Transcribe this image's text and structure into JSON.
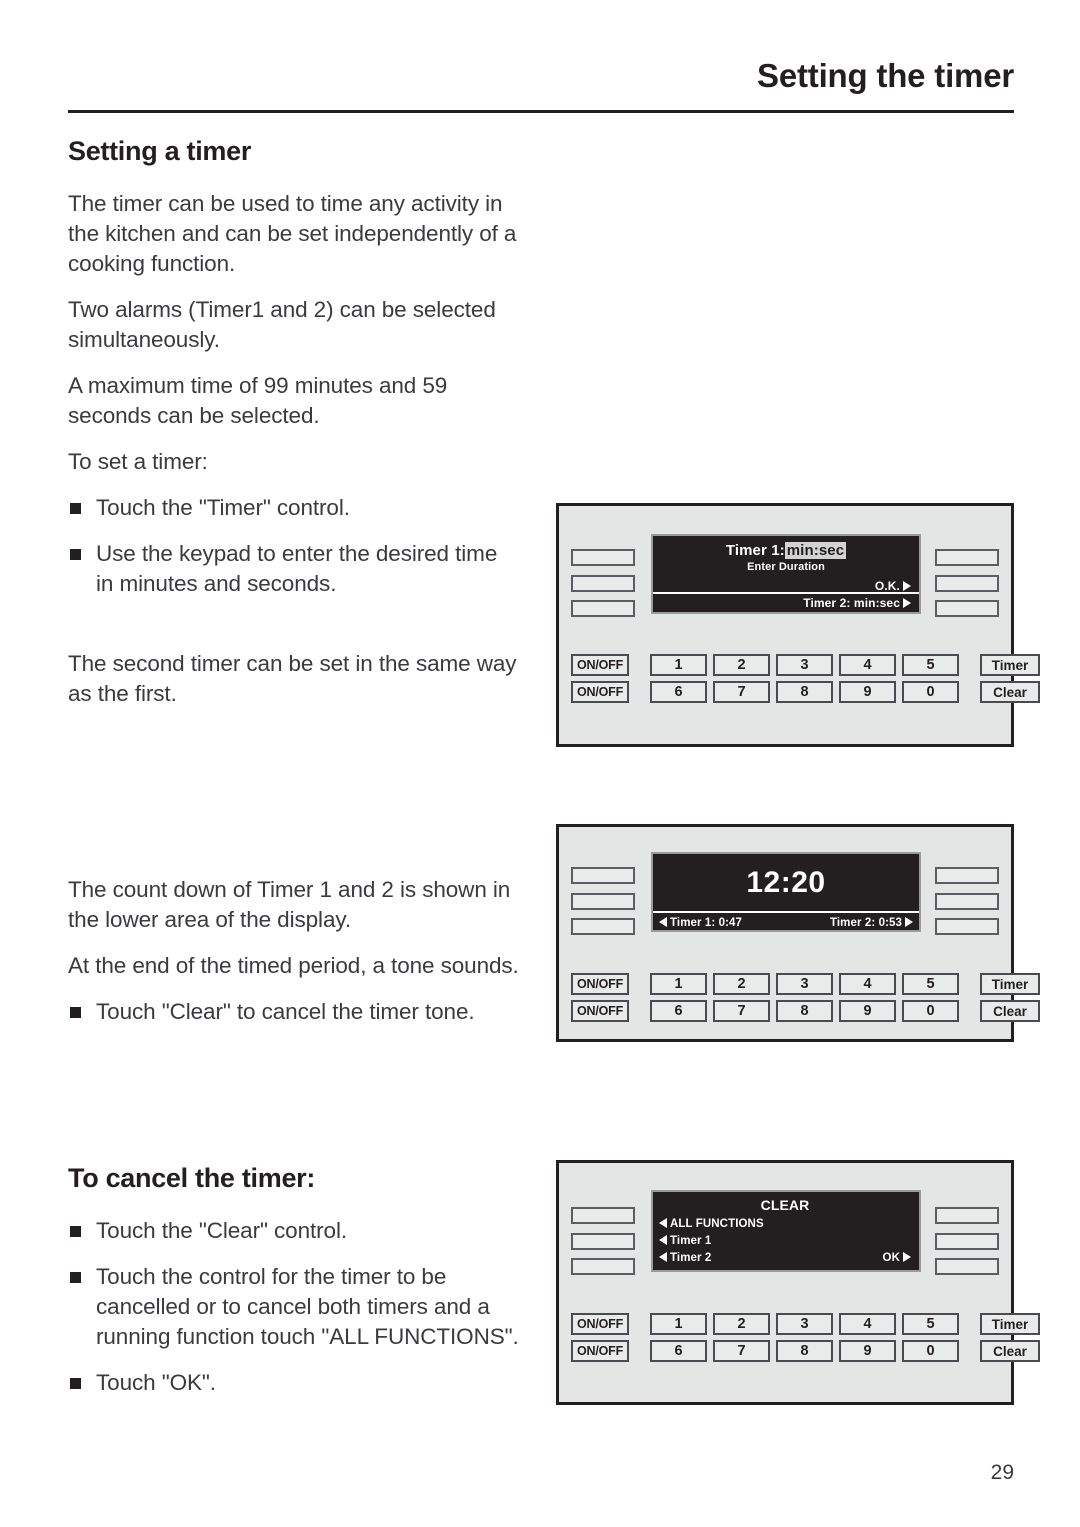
{
  "header": {
    "title": "Setting the timer"
  },
  "page_number": "29",
  "sections": {
    "setting_a_timer": {
      "heading": "Setting a timer",
      "paragraphs": [
        "The timer can be used to time any activity in the kitchen and can be set independently of a cooking function.",
        "Two alarms (Timer1 and 2) can be selected simultaneously.",
        "A maximum time of 99 minutes and 59 seconds can be selected.",
        "To set a timer:"
      ],
      "bullets": [
        "Touch the \"Timer\" control.",
        "Use the keypad to enter the desired time in minutes and seconds."
      ],
      "after_bullets": "The second timer can be set in the same way as the first."
    },
    "countdown": {
      "paragraphs": [
        "The count down of Timer 1 and 2 is shown in the lower area of the display.",
        "At the end of the timed period, a tone sounds."
      ],
      "bullets": [
        "Touch \"Clear\" to cancel the timer tone."
      ]
    },
    "cancel_the_timer": {
      "heading": "To cancel the timer:",
      "bullets": [
        "Touch the \"Clear\" control.",
        "Touch the control for the timer to be cancelled or to cancel both timers and a running function touch \"ALL FUNCTIONS\".",
        "Touch \"OK\"."
      ]
    }
  },
  "keypad": {
    "onoff_label": "ON/OFF",
    "row1": [
      "1",
      "2",
      "3",
      "4",
      "5"
    ],
    "row2": [
      "6",
      "7",
      "8",
      "9",
      "0"
    ],
    "timer_label": "Timer",
    "clear_label": "Clear"
  },
  "panels": {
    "panel1": {
      "display": {
        "title_prefix": "Timer 1:",
        "title_value": "min:sec",
        "subtitle": "Enter Duration",
        "ok_label": "O.K.",
        "bottom_bar": "Timer 2: min:sec"
      }
    },
    "panel2": {
      "display": {
        "clock": "12:20",
        "timer1": "Timer 1: 0:47",
        "timer2": "Timer 2: 0:53"
      }
    },
    "panel3": {
      "display": {
        "title": "CLEAR",
        "items": [
          "ALL FUNCTIONS",
          "Timer 1",
          "Timer 2"
        ],
        "ok_label": "OK"
      }
    }
  },
  "colors": {
    "ink": "#231f20",
    "body_text": "#3b3b3f",
    "panel_bg": "#e4e6e6",
    "display_bg": "#231f20",
    "highlight": "#d3d3d3"
  }
}
